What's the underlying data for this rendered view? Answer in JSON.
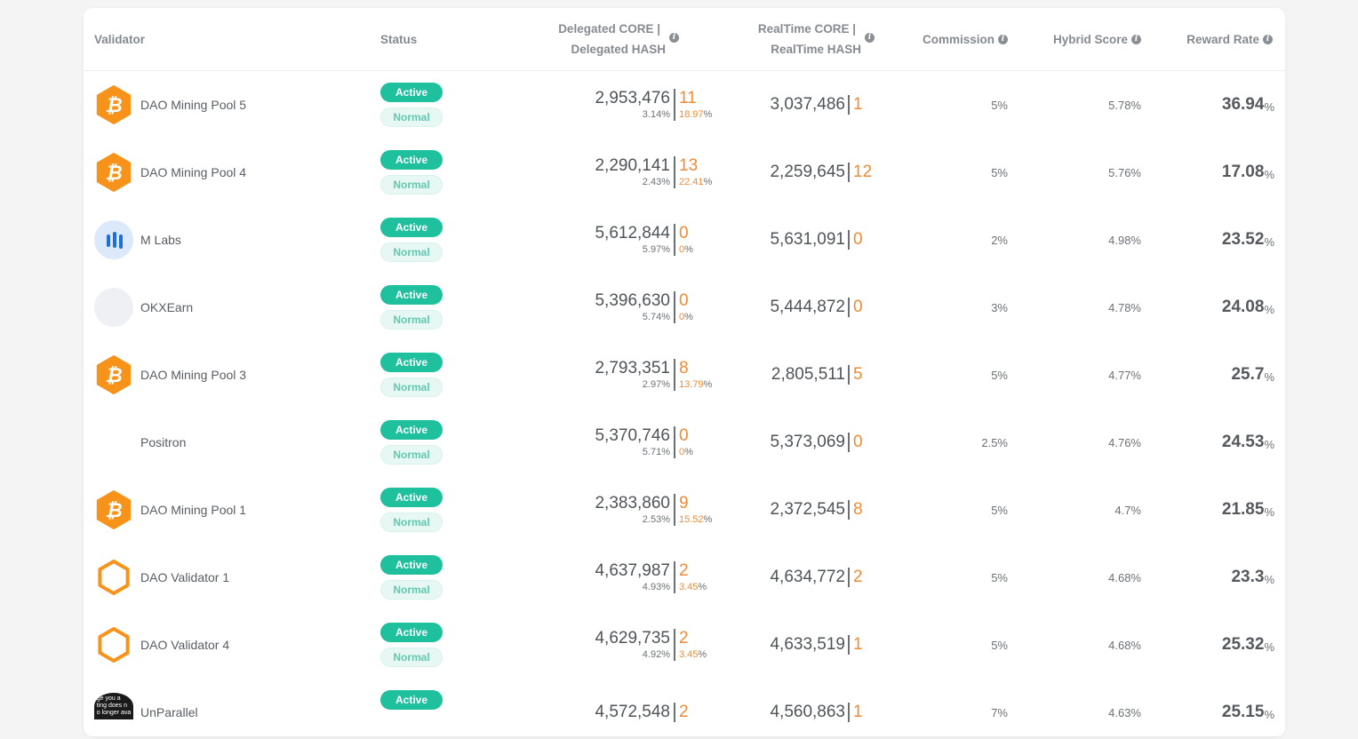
{
  "header": {
    "validator": "Validator",
    "status": "Status",
    "delegated_line1": "Delegated CORE  |",
    "delegated_line2": "Delegated HASH",
    "realtime_line1": "RealTime CORE |",
    "realtime_line2": "RealTime HASH",
    "commission": "Commission",
    "hybrid_score": "Hybrid Score",
    "reward_rate": "Reward Rate",
    "info_icon": "i"
  },
  "colors": {
    "active_badge": "#1fc09e",
    "normal_badge": "#e7f8f4",
    "hash_accent": "#f08a35",
    "bitcoin_orange": "#f7931a"
  },
  "rows": [
    {
      "name": "DAO Mining Pool 5",
      "avatar": "bitcoin-hexagon",
      "status": "Active",
      "health": "Normal",
      "deleg_core": "2,953,476",
      "deleg_hash": "11",
      "deleg_core_pct": "3.14%",
      "deleg_hash_pct_num": "18.97",
      "rt_core": "3,037,486",
      "rt_hash": "1",
      "commission": "5%",
      "hybrid": "5.78%",
      "reward": "36.94",
      "pct": "%"
    },
    {
      "name": "DAO Mining Pool 4",
      "avatar": "bitcoin-hexagon",
      "status": "Active",
      "health": "Normal",
      "deleg_core": "2,290,141",
      "deleg_hash": "13",
      "deleg_core_pct": "2.43%",
      "deleg_hash_pct_num": "22.41",
      "rt_core": "2,259,645",
      "rt_hash": "12",
      "commission": "5%",
      "hybrid": "5.76%",
      "reward": "17.08",
      "pct": "%"
    },
    {
      "name": "M Labs",
      "avatar": "mlabs-bars",
      "status": "Active",
      "health": "Normal",
      "deleg_core": "5,612,844",
      "deleg_hash": "0",
      "deleg_core_pct": "5.97%",
      "deleg_hash_pct_num": "0",
      "rt_core": "5,631,091",
      "rt_hash": "0",
      "commission": "2%",
      "hybrid": "4.98%",
      "reward": "23.52",
      "pct": "%"
    },
    {
      "name": "OKXEarn",
      "avatar": "blank-circle",
      "status": "Active",
      "health": "Normal",
      "deleg_core": "5,396,630",
      "deleg_hash": "0",
      "deleg_core_pct": "5.74%",
      "deleg_hash_pct_num": "0",
      "rt_core": "5,444,872",
      "rt_hash": "0",
      "commission": "3%",
      "hybrid": "4.78%",
      "reward": "24.08",
      "pct": "%"
    },
    {
      "name": "DAO Mining Pool 3",
      "avatar": "bitcoin-hexagon",
      "status": "Active",
      "health": "Normal",
      "deleg_core": "2,793,351",
      "deleg_hash": "8",
      "deleg_core_pct": "2.97%",
      "deleg_hash_pct_num": "13.79",
      "rt_core": "2,805,511",
      "rt_hash": "5",
      "commission": "5%",
      "hybrid": "4.77%",
      "reward": "25.7",
      "pct": "%"
    },
    {
      "name": "Positron",
      "avatar": "none",
      "status": "Active",
      "health": "Normal",
      "deleg_core": "5,370,746",
      "deleg_hash": "0",
      "deleg_core_pct": "5.71%",
      "deleg_hash_pct_num": "0",
      "rt_core": "5,373,069",
      "rt_hash": "0",
      "commission": "2.5%",
      "hybrid": "4.76%",
      "reward": "24.53",
      "pct": "%"
    },
    {
      "name": "DAO Mining Pool 1",
      "avatar": "bitcoin-hexagon",
      "status": "Active",
      "health": "Normal",
      "deleg_core": "2,383,860",
      "deleg_hash": "9",
      "deleg_core_pct": "2.53%",
      "deleg_hash_pct_num": "15.52",
      "rt_core": "2,372,545",
      "rt_hash": "8",
      "commission": "5%",
      "hybrid": "4.7%",
      "reward": "21.85",
      "pct": "%"
    },
    {
      "name": "DAO Validator 1",
      "avatar": "outline-hexagon",
      "status": "Active",
      "health": "Normal",
      "deleg_core": "4,637,987",
      "deleg_hash": "2",
      "deleg_core_pct": "4.93%",
      "deleg_hash_pct_num": "3.45",
      "rt_core": "4,634,772",
      "rt_hash": "2",
      "commission": "5%",
      "hybrid": "4.68%",
      "reward": "23.3",
      "pct": "%"
    },
    {
      "name": "DAO Validator 4",
      "avatar": "outline-hexagon",
      "status": "Active",
      "health": "Normal",
      "deleg_core": "4,629,735",
      "deleg_hash": "2",
      "deleg_core_pct": "4.92%",
      "deleg_hash_pct_num": "3.45",
      "rt_core": "4,633,519",
      "rt_hash": "1",
      "commission": "5%",
      "hybrid": "4.68%",
      "reward": "25.32",
      "pct": "%"
    },
    {
      "name": "UnParallel",
      "avatar": "broken-image",
      "avatar_text": "ge you a\nting does n\no longer ava",
      "status": "Active",
      "health": "",
      "deleg_core": "4,572,548",
      "deleg_hash": "2",
      "deleg_core_pct": "",
      "deleg_hash_pct_num": "",
      "rt_core": "4,560,863",
      "rt_hash": "1",
      "commission": "7%",
      "hybrid": "4.63%",
      "reward": "25.15",
      "pct": "%"
    }
  ]
}
